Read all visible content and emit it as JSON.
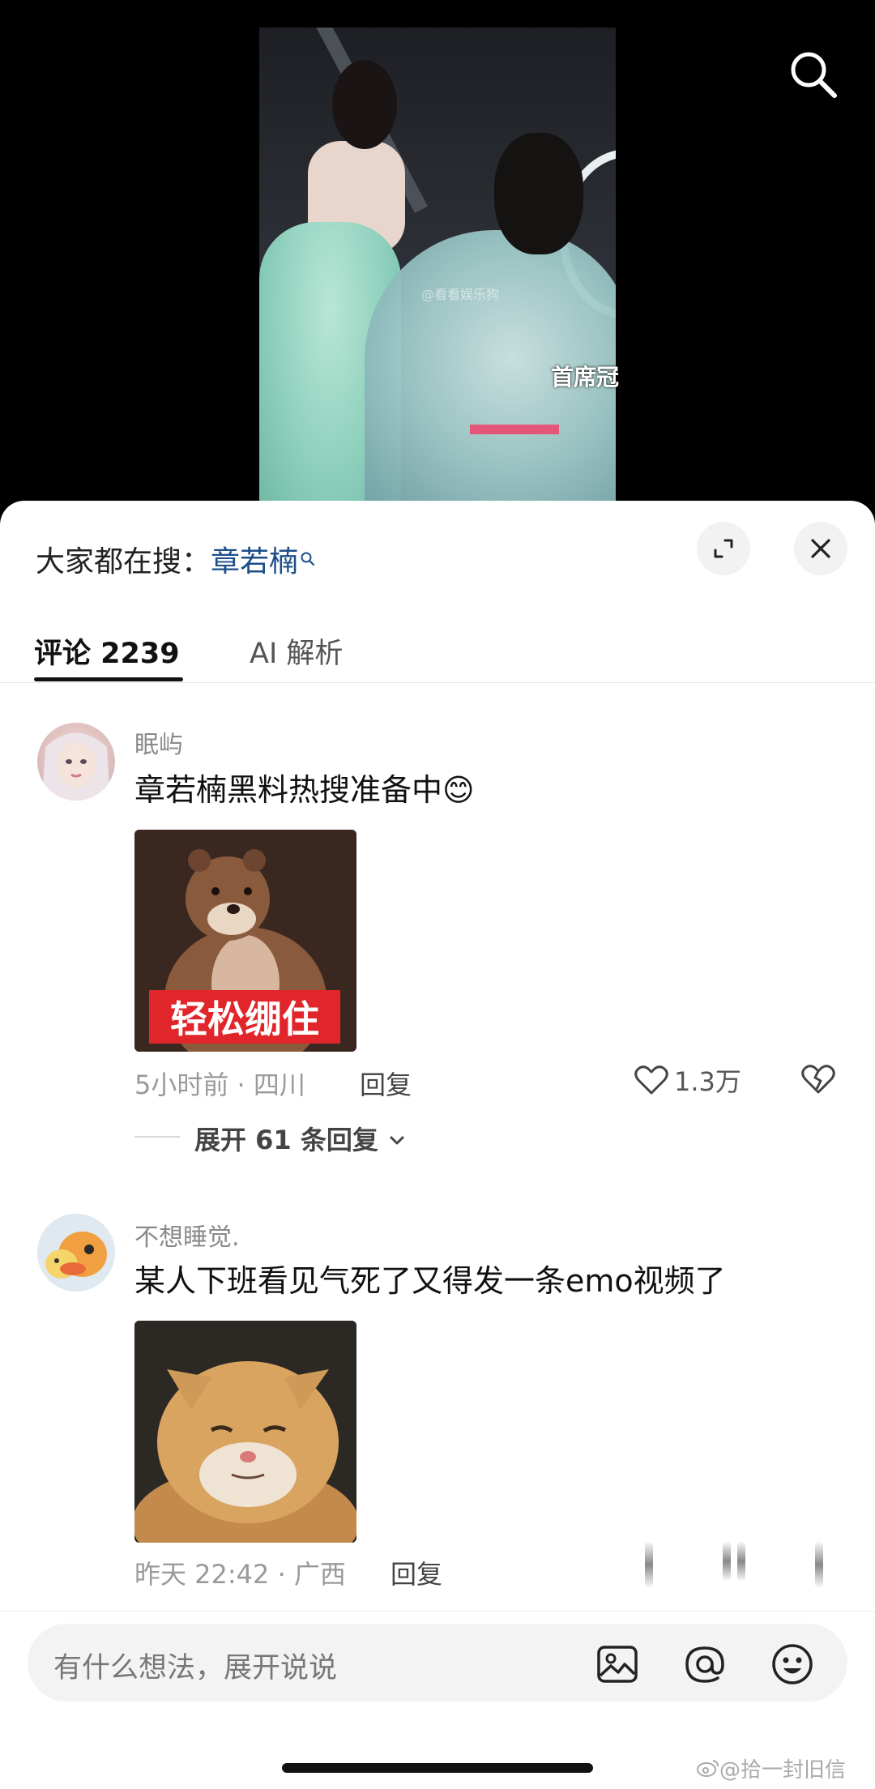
{
  "video": {
    "overlay_text": "首席冠",
    "watermark": "@看看娱乐狗"
  },
  "sheet": {
    "trending_prefix": "大家都在搜：",
    "trending_keyword": "章若楠",
    "tabs": [
      {
        "label": "评论 2239",
        "active": true
      },
      {
        "label": "AI 解析",
        "active": false
      }
    ]
  },
  "comments": [
    {
      "username": "眠屿",
      "text": "章若楠黑料热搜准备中😊",
      "image_caption": "轻松绷住",
      "time_location": "5小时前 · 四川",
      "reply_label": "回复",
      "likes": "1.3万",
      "expand_label": "展开 61 条回复"
    },
    {
      "username": "不想睡觉.",
      "text": "某人下班看见气死了又得发一条emo视频了",
      "time_location": "昨天 22:42 · 广西",
      "reply_label": "回复"
    }
  ],
  "input": {
    "placeholder": "有什么想法，展开说说"
  },
  "corner_watermark": "@拾一封旧信",
  "colors": {
    "keyword": "#1c4e8a",
    "caption_bg": "#e0262a"
  }
}
